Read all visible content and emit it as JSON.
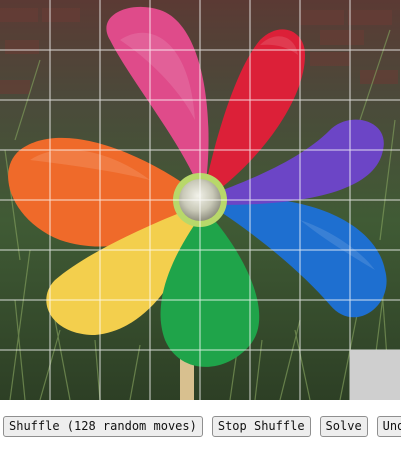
{
  "puzzle": {
    "image_subject": "colorful-pinwheel-photo",
    "rows": 8,
    "cols": 8,
    "empty_tile": {
      "row": 8,
      "col": 8
    },
    "colors": {
      "grid_line": "#ffffff",
      "empty_tile": "#cfcfcf",
      "background_foliage": "#3f5a35",
      "brick_wall": "#6b3c35"
    }
  },
  "controls": {
    "shuffle_label": "Shuffle (128 random moves)",
    "stop_shuffle_label": "Stop Shuffle",
    "solve_label": "Solve",
    "undo_label": "Undo"
  }
}
